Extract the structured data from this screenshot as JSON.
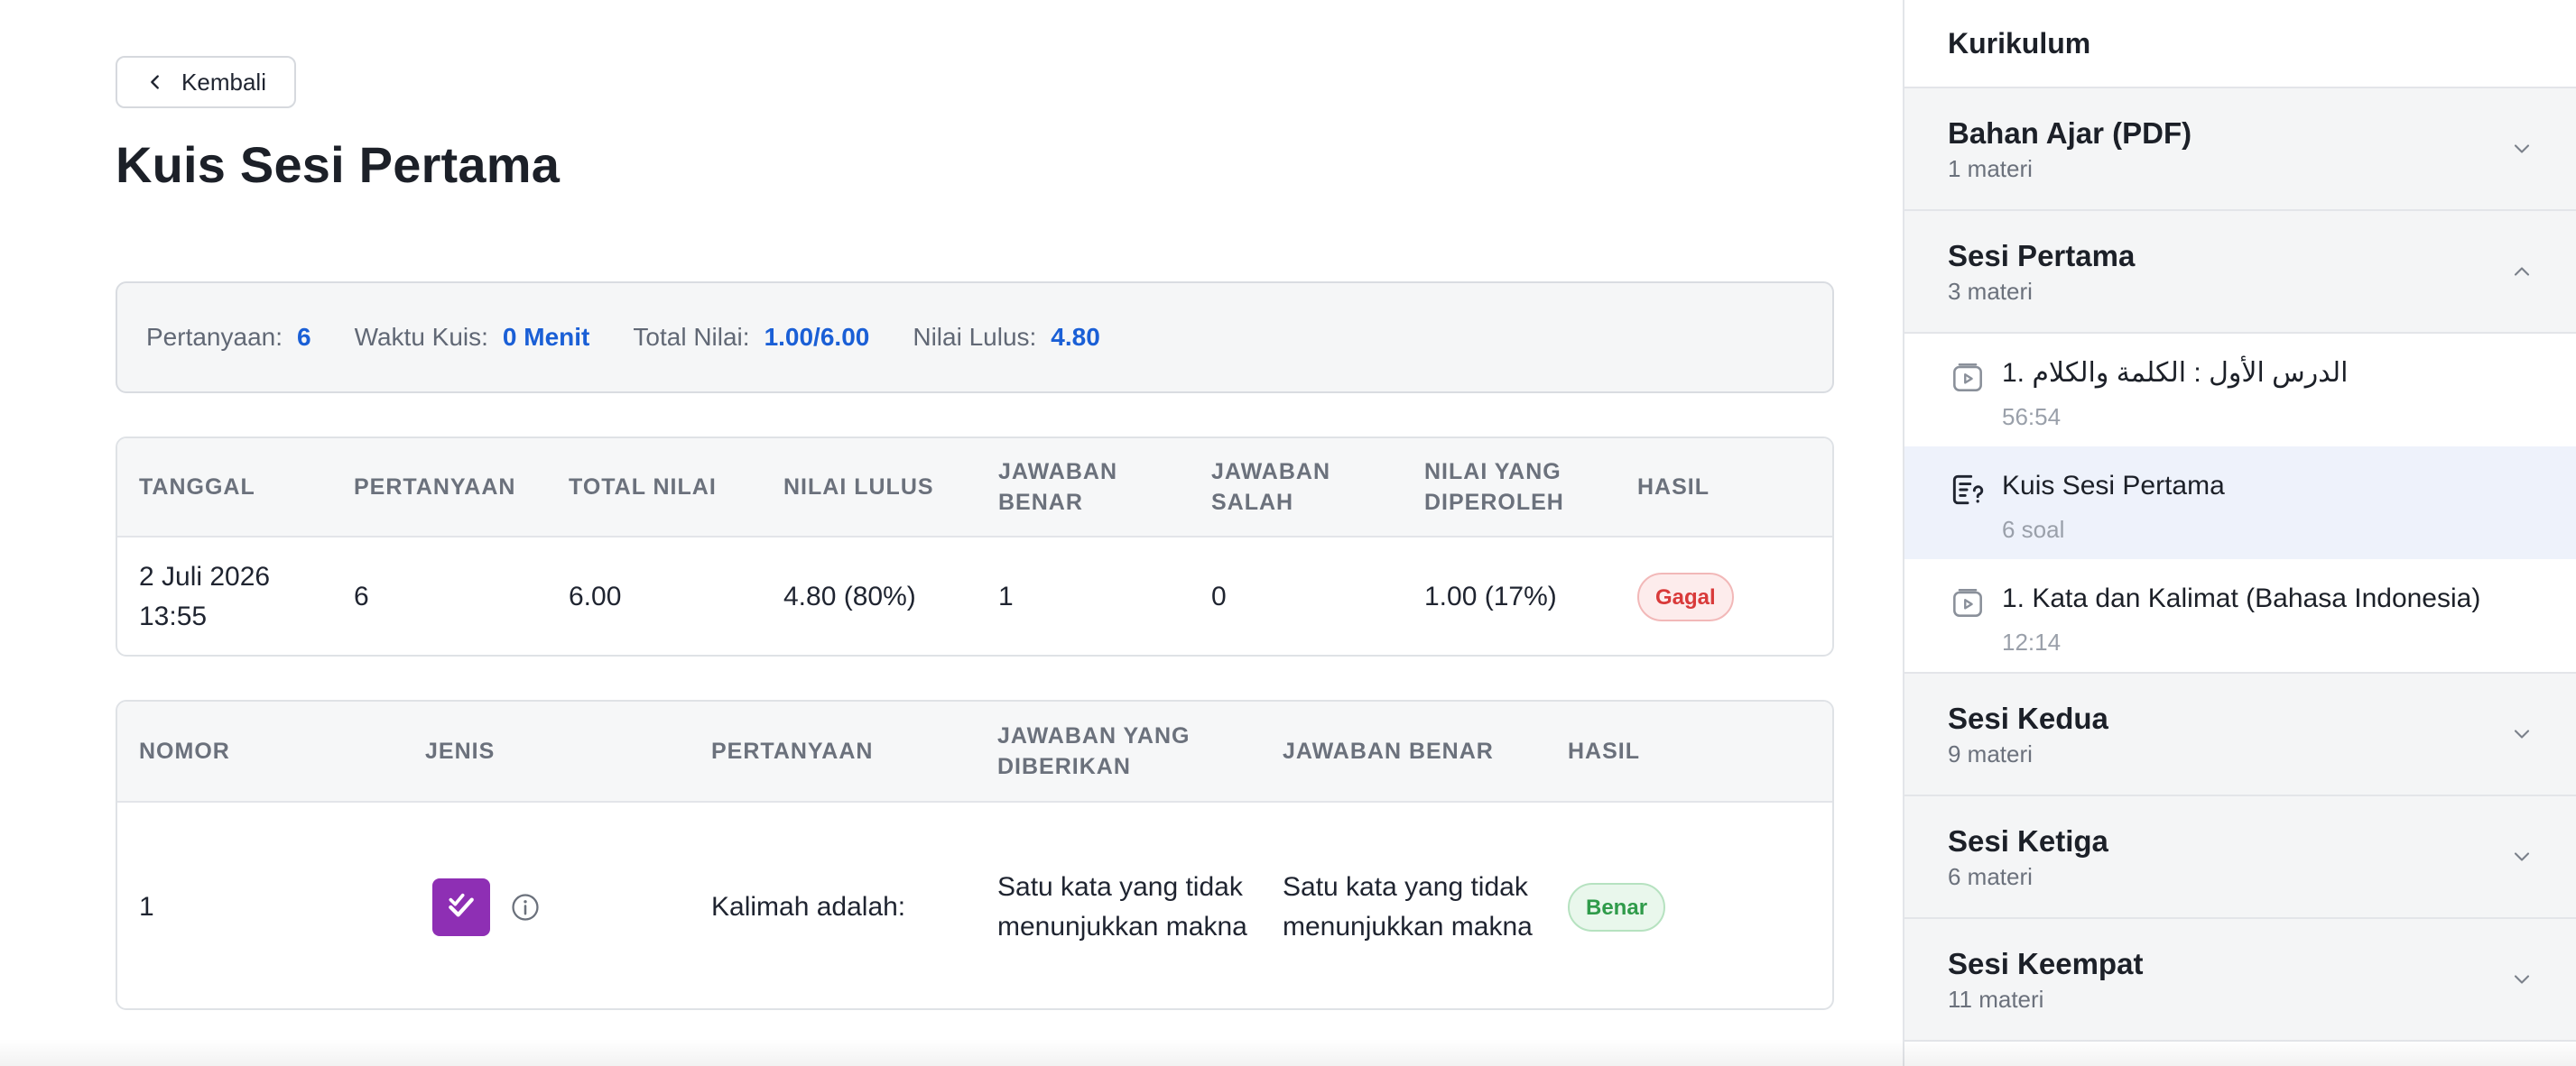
{
  "back_button": {
    "label": "Kembali"
  },
  "page_title": "Kuis Sesi Pertama",
  "summary": {
    "questions_label": "Pertanyaan:",
    "questions_value": "6",
    "time_label": "Waktu Kuis:",
    "time_value": "0 Menit",
    "total_label": "Total Nilai:",
    "total_value": "1.00/6.00",
    "pass_label": "Nilai Lulus:",
    "pass_value": "4.80"
  },
  "results_table": {
    "headers": [
      "TANGGAL",
      "PERTANYAAN",
      "TOTAL NILAI",
      "NILAI LULUS",
      "JAWABAN BENAR",
      "JAWABAN SALAH",
      "NILAI YANG DIPEROLEH",
      "HASIL"
    ],
    "row": {
      "date": "2 Juli 2026 13:55",
      "questions": "6",
      "total": "6.00",
      "pass_score": "4.80 (80%)",
      "correct": "1",
      "wrong": "0",
      "obtained": "1.00 (17%)",
      "result": "Gagal"
    }
  },
  "answers_table": {
    "headers": [
      "NOMOR",
      "JENIS",
      "PERTANYAAN",
      "JAWABAN YANG DIBERIKAN",
      "JAWABAN BENAR",
      "HASIL"
    ],
    "row": {
      "number": "1",
      "type_icon": "multiple-choice-check-icon",
      "question": "Kalimah adalah:",
      "given": "Satu kata yang tidak menunjukkan makna",
      "correct": "Satu kata yang tidak menunjukkan makna",
      "result": "Benar"
    }
  },
  "sidebar": {
    "title": "Kurikulum",
    "sections": [
      {
        "name": "Bahan Ajar (PDF)",
        "count": "1 materi",
        "expanded": false
      },
      {
        "name": "Sesi Pertama",
        "count": "3 materi",
        "expanded": true,
        "lessons": [
          {
            "title": "1. الدرس الأول : الكلمة والكلام",
            "sub": "56:54",
            "icon": "video-icon",
            "active": false
          },
          {
            "title": "Kuis Sesi Pertama",
            "sub": "6 soal",
            "icon": "quiz-icon",
            "active": true
          },
          {
            "title": "1. Kata dan Kalimat (Bahasa Indonesia)",
            "sub": "12:14",
            "icon": "video-icon",
            "active": false
          }
        ]
      },
      {
        "name": "Sesi Kedua",
        "count": "9 materi",
        "expanded": false
      },
      {
        "name": "Sesi Ketiga",
        "count": "6 materi",
        "expanded": false
      },
      {
        "name": "Sesi Keempat",
        "count": "11 materi",
        "expanded": false
      }
    ]
  },
  "colors": {
    "accent": "#1a5fd6",
    "fail": "#d93a3a",
    "pass": "#2f9b4a",
    "quiz_type": "#8e2fb4",
    "active_bg": "#eef2fb"
  }
}
